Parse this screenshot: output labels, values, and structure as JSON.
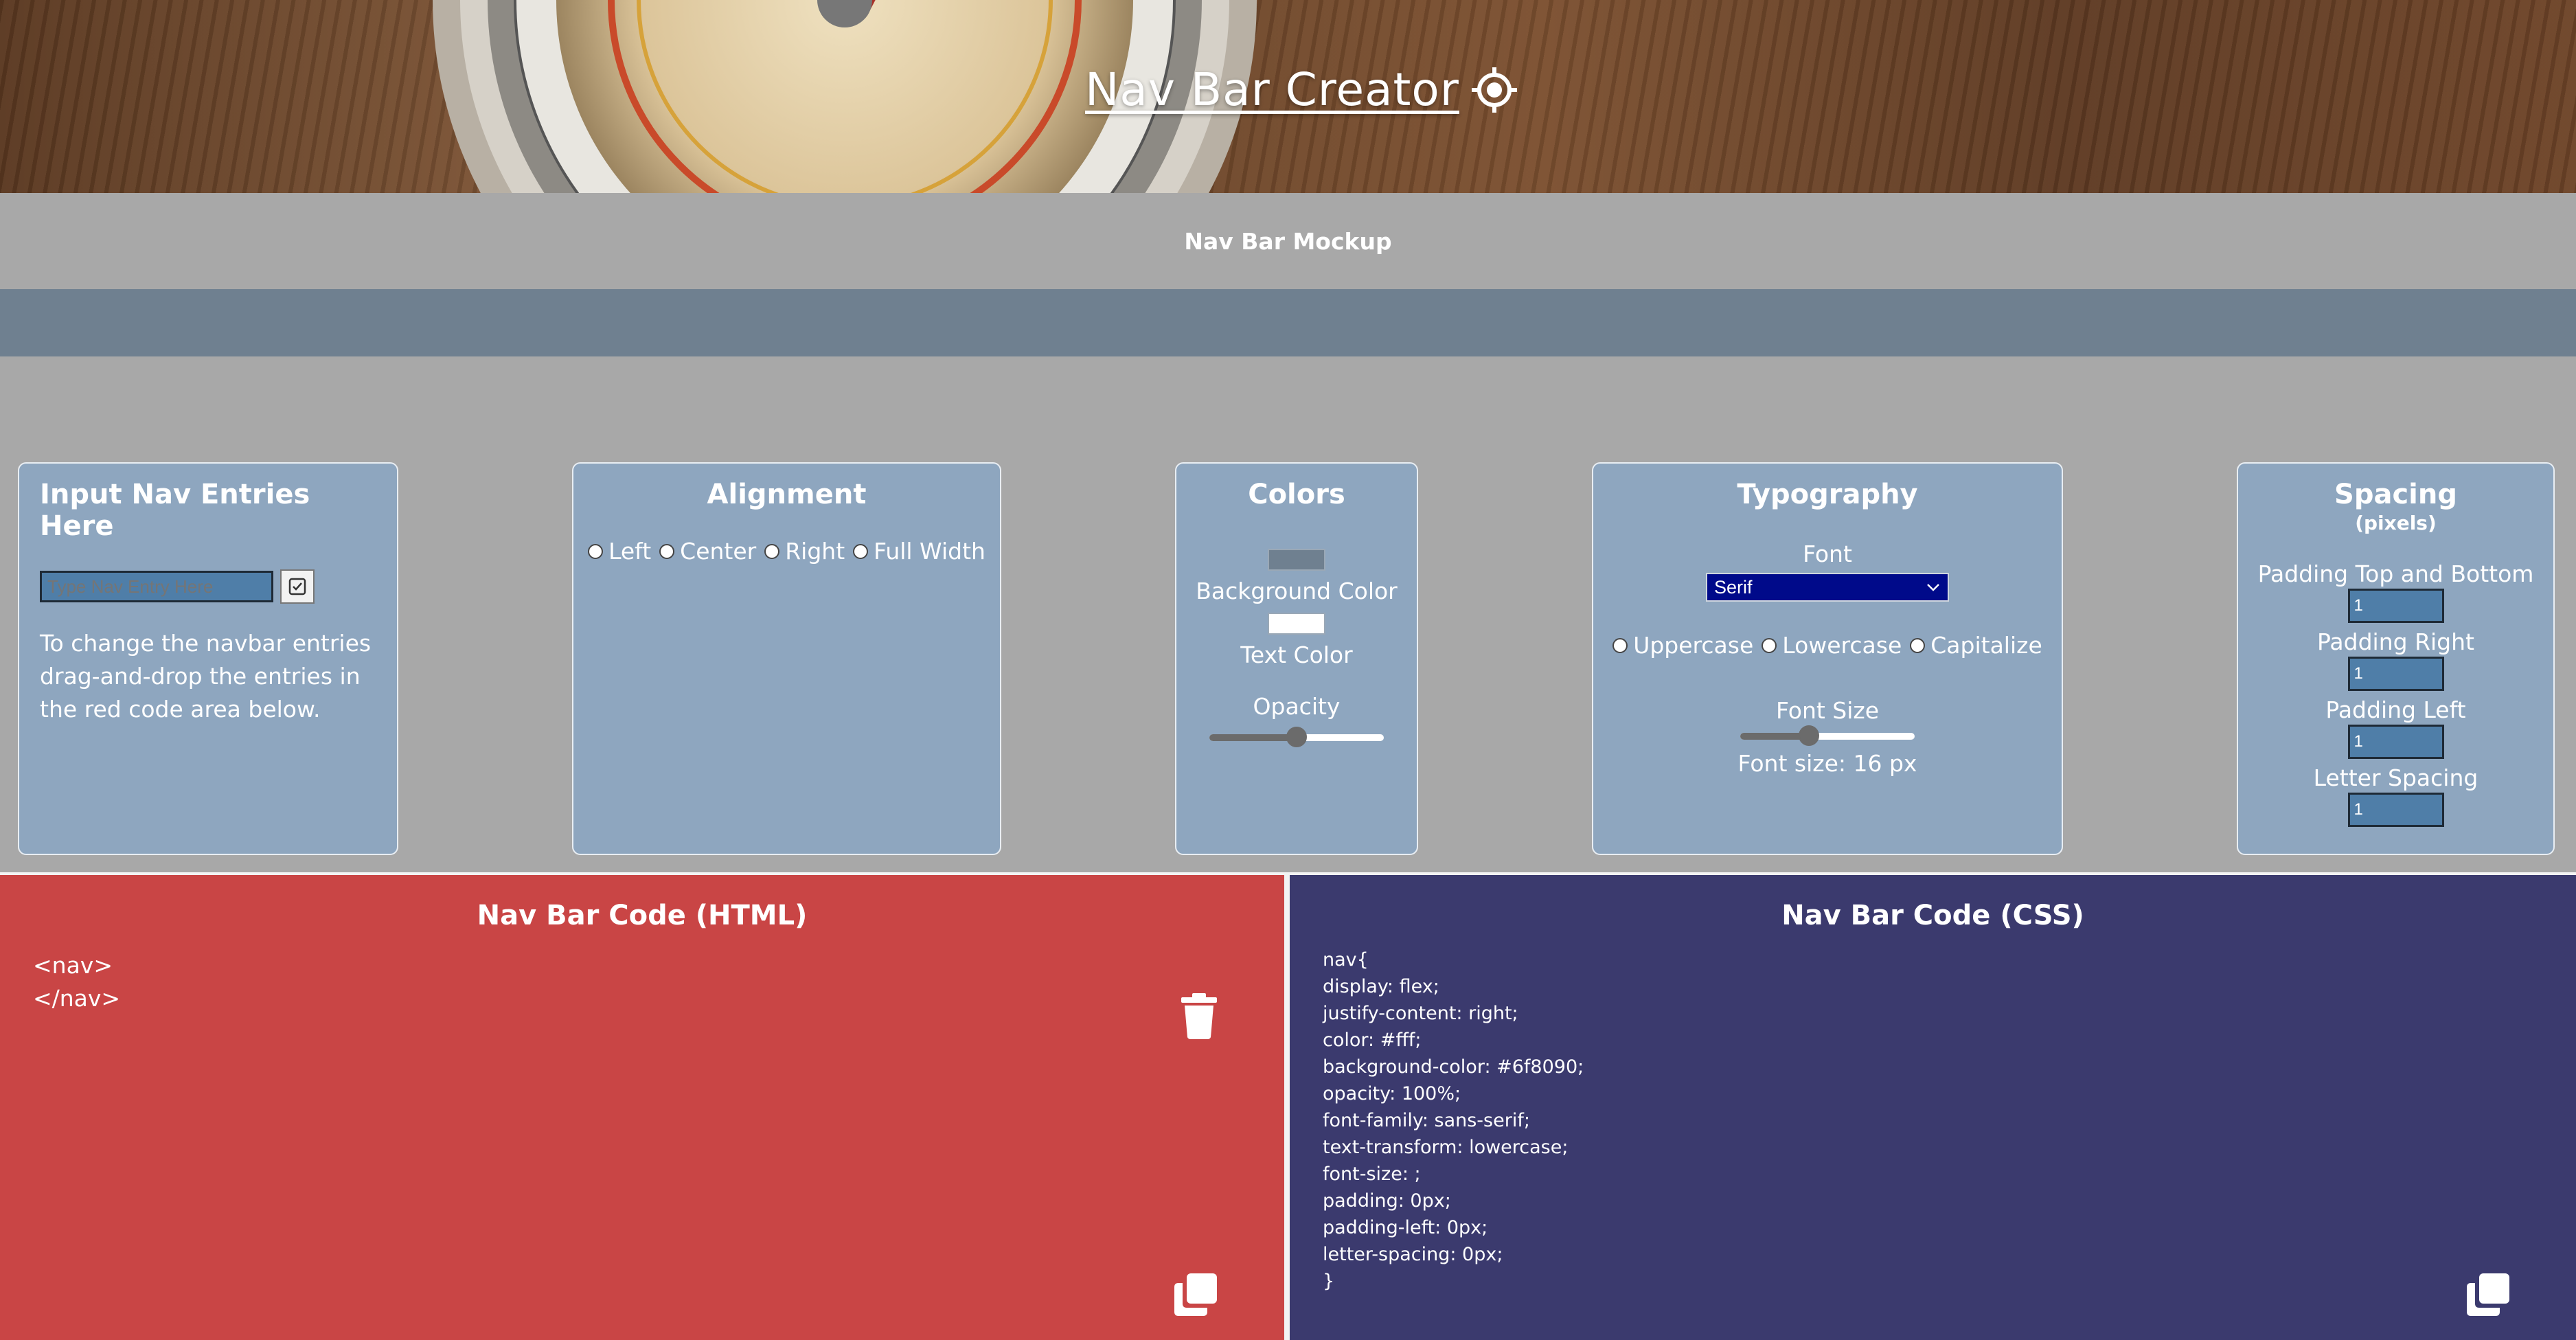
{
  "header": {
    "title": "Nav Bar Creator",
    "title_icon": "crosshair-icon",
    "background": "compass-photo"
  },
  "mockup": {
    "label": "Nav Bar Mockup",
    "nav_background": "#6f8090"
  },
  "panels": {
    "entries": {
      "title": "Input Nav Entries Here",
      "input_placeholder": "Type Nav Entry Here",
      "submit_icon": "check-square-icon",
      "help_lines": [
        "To change the navbar entries",
        "drag-and-drop the entries in",
        "the red code area below."
      ]
    },
    "alignment": {
      "title": "Alignment",
      "options": [
        "Left",
        "Center",
        "Right",
        "Full Width"
      ]
    },
    "colors": {
      "title": "Colors",
      "background_label": "Background Color",
      "background_value": "#6f8090",
      "text_label": "Text Color",
      "text_value": "#ffffff",
      "opacity_label": "Opacity",
      "opacity_value": 0.5
    },
    "typography": {
      "title": "Typography",
      "font_label": "Font",
      "font_selected": "Serif",
      "transform_options": [
        "Uppercase",
        "Lowercase",
        "Capitalize"
      ],
      "size_label": "Font Size",
      "size_slider_value": 0.38,
      "size_readout": "Font size: 16 px"
    },
    "spacing": {
      "title": "Spacing",
      "subtitle": "(pixels)",
      "fields": [
        {
          "label": "Padding Top and Bottom",
          "value": "1"
        },
        {
          "label": "Padding Right",
          "value": "1"
        },
        {
          "label": "Padding Left",
          "value": "1"
        },
        {
          "label": "Letter Spacing",
          "value": "1"
        }
      ]
    }
  },
  "code_html": {
    "title": "Nav Bar Code (HTML)",
    "lines": [
      "<nav>",
      "</nav>"
    ],
    "delete_icon": "trash-icon",
    "copy_icon": "copy-icon",
    "background": "#c94545"
  },
  "code_css": {
    "title": "Nav Bar Code (CSS)",
    "lines": [
      "nav{",
      "display: flex;",
      "justify-content: right;",
      "color: #fff;",
      "background-color: #6f8090;",
      "opacity: 100%;",
      "font-family: sans-serif;",
      "text-transform: lowercase;",
      "font-size: ;",
      "padding: 0px;",
      "padding-left: 0px;",
      "letter-spacing: 0px;",
      "}"
    ],
    "copy_icon": "copy-icon",
    "background": "#3b3a6e"
  }
}
